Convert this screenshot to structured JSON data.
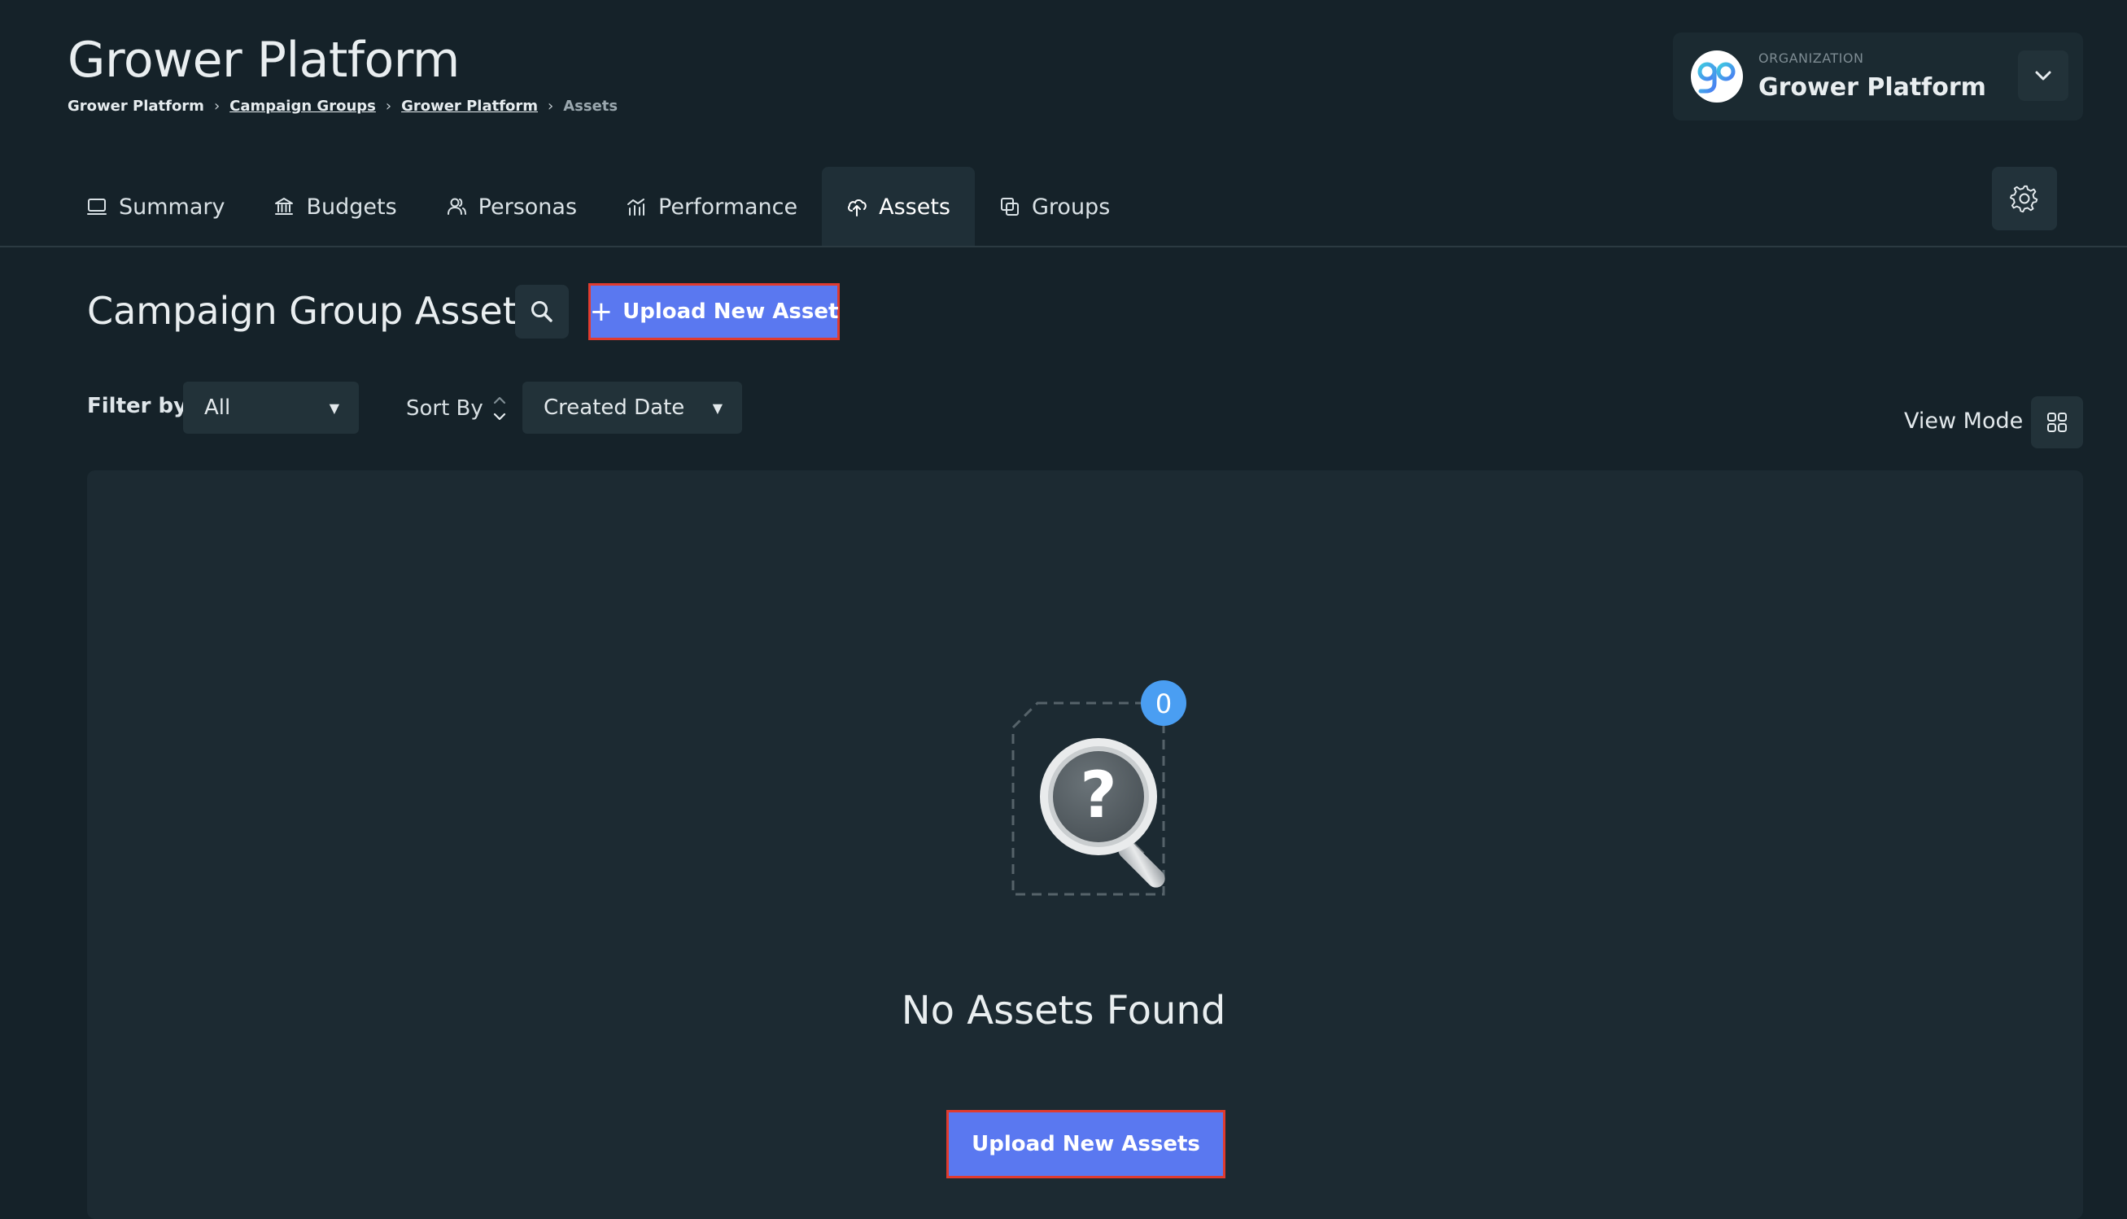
{
  "header": {
    "title": "Grower Platform",
    "breadcrumb": {
      "item1": "Grower Platform",
      "item2": "Campaign Groups",
      "item3": "Grower Platform",
      "current": "Assets",
      "separator": "›"
    }
  },
  "organization": {
    "label": "ORGANIZATION",
    "name": "Grower Platform",
    "logo_text": "gp"
  },
  "tabs": [
    {
      "label": "Summary",
      "icon": "monitor-icon"
    },
    {
      "label": "Budgets",
      "icon": "bank-icon"
    },
    {
      "label": "Personas",
      "icon": "users-icon"
    },
    {
      "label": "Performance",
      "icon": "chart-icon"
    },
    {
      "label": "Assets",
      "icon": "cloud-upload-icon",
      "active": true
    },
    {
      "label": "Groups",
      "icon": "copy-icon"
    }
  ],
  "section": {
    "title": "Campaign Group Assets",
    "upload_label": "Upload New Asset",
    "upload_icon": "+"
  },
  "filters": {
    "filter_label": "Filter by",
    "filter_value": "All",
    "sort_label": "Sort By",
    "sort_value": "Created Date",
    "view_mode_label": "View Mode"
  },
  "empty_state": {
    "count": "0",
    "question_mark": "?",
    "title": "No Assets Found",
    "button_label": "Upload New Assets"
  },
  "colors": {
    "background": "#152229",
    "panel": "#1c2a32",
    "accent": "#5a78f0",
    "highlight_border": "#e03b2f",
    "badge": "#4a9ef2"
  }
}
